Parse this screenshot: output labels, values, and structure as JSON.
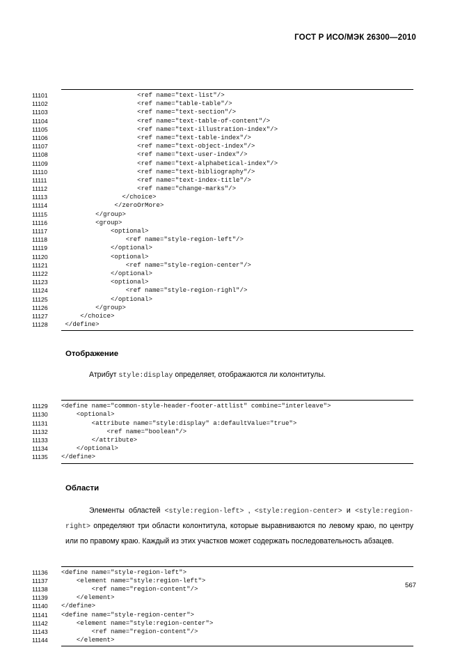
{
  "header": {
    "standard_ref": "ГОСТ Р ИСО/МЭК 26300—2010"
  },
  "footer": {
    "page_number": "567"
  },
  "listing_1": {
    "lines": [
      {
        "no": "11101",
        "code": "                    <ref name=\"text-list\"/>"
      },
      {
        "no": "11102",
        "code": "                    <ref name=\"table-table\"/>"
      },
      {
        "no": "11103",
        "code": "                    <ref name=\"text-section\"/>"
      },
      {
        "no": "11104",
        "code": "                    <ref name=\"text-table-of-content\"/>"
      },
      {
        "no": "11105",
        "code": "                    <ref name=\"text-illustration-index\"/>"
      },
      {
        "no": "11106",
        "code": "                    <ref name=\"text-table-index\"/>"
      },
      {
        "no": "11107",
        "code": "                    <ref name=\"text-object-index\"/>"
      },
      {
        "no": "11108",
        "code": "                    <ref name=\"text-user-index\"/>"
      },
      {
        "no": "11109",
        "code": "                    <ref name=\"text-alphabetical-index\"/>"
      },
      {
        "no": "11110",
        "code": "                    <ref name=\"text-bibliography\"/>"
      },
      {
        "no": "11111",
        "code": "                    <ref name=\"text-index-title\"/>"
      },
      {
        "no": "11112",
        "code": "                    <ref name=\"change-marks\"/>"
      },
      {
        "no": "11113",
        "code": "                </choice>"
      },
      {
        "no": "11114",
        "code": "              </zeroOrMore>"
      },
      {
        "no": "11115",
        "code": "         </group>"
      },
      {
        "no": "11116",
        "code": "         <group>"
      },
      {
        "no": "11117",
        "code": "             <optional>"
      },
      {
        "no": "11118",
        "code": "                 <ref name=\"style-region-left\"/>"
      },
      {
        "no": "11119",
        "code": "             </optional>"
      },
      {
        "no": "11120",
        "code": "             <optional>"
      },
      {
        "no": "11121",
        "code": "                 <ref name=\"style-region-center\"/>"
      },
      {
        "no": "11122",
        "code": "             </optional>"
      },
      {
        "no": "11123",
        "code": "             <optional>"
      },
      {
        "no": "11124",
        "code": "                 <ref name=\"style-region-righl\"/>"
      },
      {
        "no": "11125",
        "code": "             </optional>"
      },
      {
        "no": "11126",
        "code": "         </group>"
      },
      {
        "no": "11127",
        "code": "     </choice>"
      },
      {
        "no": "11128",
        "code": " </define>"
      }
    ]
  },
  "section_display": {
    "heading": "Отображение",
    "paragraph_before": "Атрибут ",
    "paragraph_code": "style:display",
    "paragraph_after": " определяет, отображаются ли колонтитулы."
  },
  "listing_2": {
    "lines": [
      {
        "no": "11129",
        "code": "<define name=\"common-style-header-footer-attlist\" combine=\"interleave\">"
      },
      {
        "no": "11130",
        "code": "    <optional>"
      },
      {
        "no": "11131",
        "code": "        <attribute name=\"style:display\" a:defaultValue=\"true\">"
      },
      {
        "no": "11132",
        "code": "            <ref name=\"boolean\"/>"
      },
      {
        "no": "11133",
        "code": "        </attribute>"
      },
      {
        "no": "11134",
        "code": "    </optional>"
      },
      {
        "no": "11135",
        "code": "</define>"
      }
    ]
  },
  "section_regions": {
    "heading": "Области",
    "para_line1_before": "Элементы областей ",
    "para_line1_code1": "<style:region-left>",
    "para_line1_mid": " , ",
    "para_line1_code2": "<style:region-center>",
    "para_line1_after": " и",
    "para_line2_code": "<style:region-right>",
    "para_line2_after": " определяют три области колонтитула, которые выравниваются по левому краю, по центру или по правому краю. Каждый из этих участков может содержать последовательность абзацев."
  },
  "listing_3": {
    "lines": [
      {
        "no": "11136",
        "code": "<define name=\"style-region-left\">"
      },
      {
        "no": "11137",
        "code": "    <element name=\"style:region-left\">"
      },
      {
        "no": "11138",
        "code": "        <ref name=\"region-content\"/>"
      },
      {
        "no": "11139",
        "code": "    </element>"
      },
      {
        "no": "11140",
        "code": "</define>"
      },
      {
        "no": "11141",
        "code": "<define name=\"style-region-center\">"
      },
      {
        "no": "11142",
        "code": "    <element name=\"style:region-center\">"
      },
      {
        "no": "11143",
        "code": "        <ref name=\"region-content\"/>"
      },
      {
        "no": "11144",
        "code": "    </element>"
      }
    ]
  }
}
